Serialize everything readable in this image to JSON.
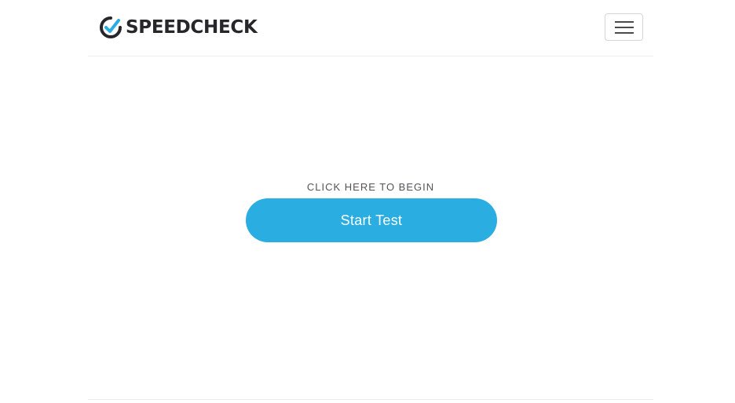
{
  "header": {
    "brand_name": "SPEEDCHECK",
    "logo_icon": "gauge-check-icon",
    "menu_icon": "hamburger-menu-icon"
  },
  "main": {
    "cta_label": "CLICK HERE TO BEGIN",
    "start_button_label": "Start Test"
  },
  "colors": {
    "accent": "#2aade1",
    "brand_dark": "#26262b",
    "label_text": "#555258",
    "divider": "#ececec"
  }
}
